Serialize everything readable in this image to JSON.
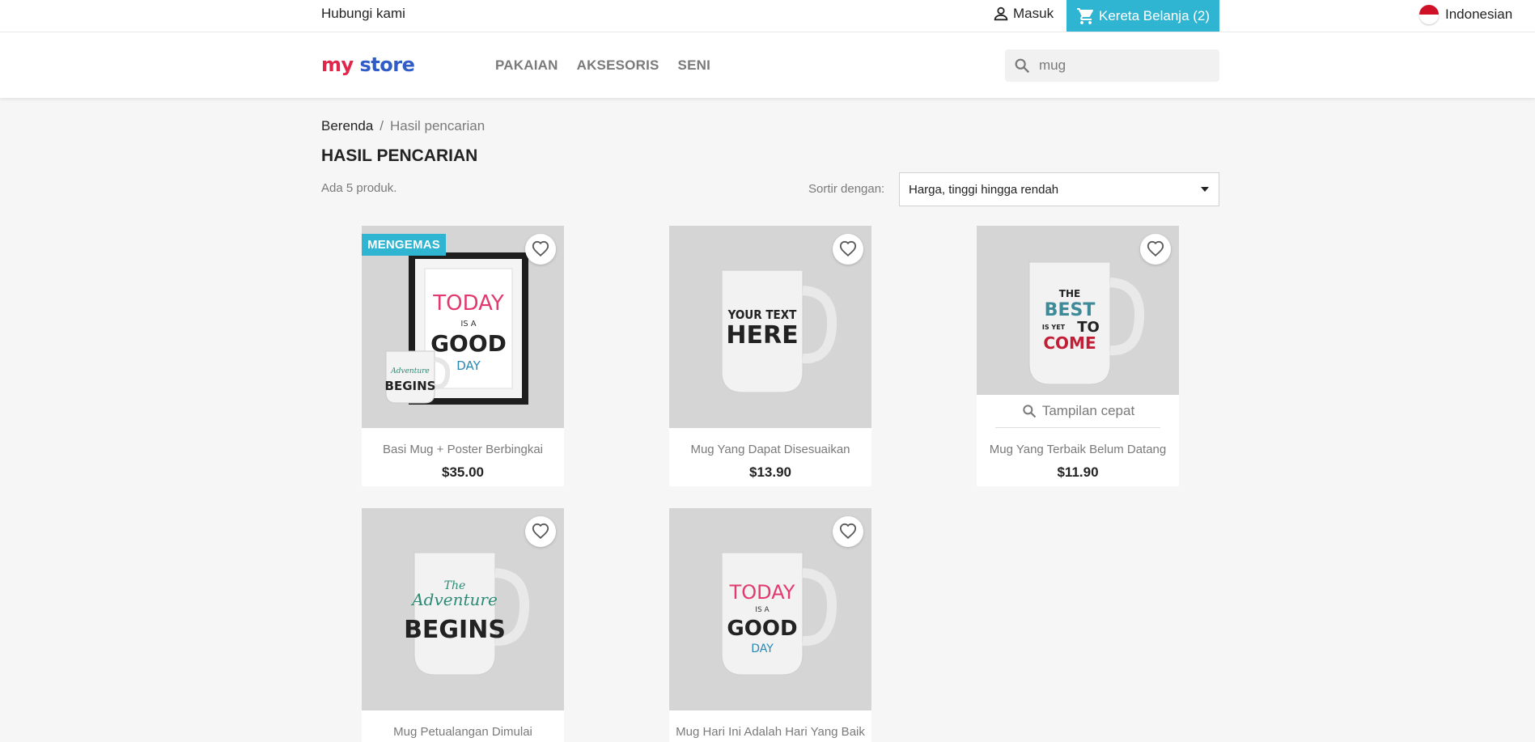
{
  "topbar": {
    "contact": "Hubungi kami",
    "signin": "Masuk",
    "cart": "Kereta Belanja (2)",
    "language": "Indonesian"
  },
  "header": {
    "logo": {
      "word1": "my",
      "word2": "store"
    },
    "nav": [
      "PAKAIAN",
      "AKSESORIS",
      "SENI"
    ],
    "search_value": "mug"
  },
  "breadcrumb": {
    "home": "Berenda",
    "separator": "/",
    "current": "Hasil pencarian"
  },
  "page_title": "HASIL PENCARIAN",
  "total_products": "Ada 5 produk.",
  "sort": {
    "label": "Sortir dengan:",
    "selected": "Harga, tinggi hingga rendah"
  },
  "products": [
    {
      "name": "Basi Mug + Poster Berbingkai",
      "price": "$35.00",
      "flag": "MENGEMAS",
      "art": [
        "TODAY",
        "IS A",
        "GOOD",
        "DAY"
      ]
    },
    {
      "name": "Mug Yang Dapat Disesuaikan",
      "price": "$13.90",
      "art": [
        "YOUR TEXT",
        "HERE"
      ]
    },
    {
      "name": "Mug Yang Terbaik Belum Datang",
      "price": "$11.90",
      "quick_view": "Tampilan cepat",
      "art": [
        "THE",
        "BEST",
        "IS YET",
        "TO",
        "COME"
      ]
    },
    {
      "name": "Mug Petualangan Dimulai",
      "art": [
        "The",
        "Adventure",
        "BEGINS"
      ]
    },
    {
      "name": "Mug Hari Ini Adalah Hari Yang Baik",
      "art": [
        "TODAY",
        "IS A",
        "GOOD",
        "DAY"
      ]
    }
  ],
  "colors": {
    "accent": "#2fb5d2",
    "text": "#232323",
    "muted": "#7a7a7a",
    "background": "#f6f6f6"
  }
}
